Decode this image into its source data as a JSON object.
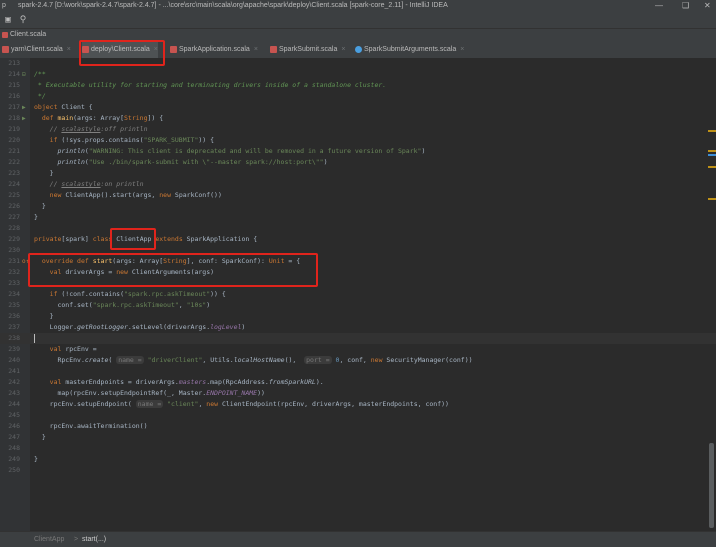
{
  "window": {
    "title": "spark-2.4.7 [D:\\work\\spark-2.4.7\\spark-2.4.7] - ...\\core\\src\\main\\scala\\org\\apache\\spark\\deploy\\Client.scala [spark-core_2.11] - IntelliJ IDEA",
    "logo": "p",
    "minimize": "—",
    "maximize": "❑",
    "close": "✕"
  },
  "breadcrumb": {
    "file": "Client.scala"
  },
  "tabs": [
    {
      "label": "yarn\\Client.scala",
      "icon": "scala-file-icon"
    },
    {
      "label": "deploy\\Client.scala",
      "icon": "scala-file-icon",
      "active": true
    },
    {
      "label": "SparkApplication.scala",
      "icon": "scala-file-icon"
    },
    {
      "label": "SparkSubmit.scala",
      "icon": "scala-file-icon"
    },
    {
      "label": "SparkSubmitArguments.scala",
      "icon": "scala-class-icon"
    }
  ],
  "tab_close": "×",
  "code": {
    "l213": "",
    "l214": "/**",
    "l215": " * Executable utility for starting and terminating drivers inside of a standalone cluster.",
    "l216": " */",
    "l217": {
      "a": "object",
      "b": " Client {"
    },
    "l218": {
      "a": "  def ",
      "b": "main",
      "c": "(args: Array[",
      "d": "String",
      "e": "]) {"
    },
    "l219": {
      "a": "    // ",
      "b": "scalastyle",
      "c": ":off println"
    },
    "l220": {
      "a": "    if",
      "b": " (!sys.props.contains(",
      "c": "\"SPARK_SUBMIT\"",
      "d": ")) {"
    },
    "l221": {
      "a": "      println",
      "b": "(",
      "c": "\"WARNING: This client is deprecated and will be removed in a future version of Spark\"",
      "d": ")"
    },
    "l222": {
      "a": "      println",
      "b": "(",
      "c": "\"Use ./bin/spark-submit with \\\"--master spark://host:port\\\"\"",
      "d": ")"
    },
    "l223": "    }",
    "l224": {
      "a": "    // ",
      "b": "scalastyle",
      "c": ":on println"
    },
    "l225": {
      "a": "    new",
      "b": " ClientApp().start(args, ",
      "c": "new",
      "d": " SparkConf())"
    },
    "l226": "  }",
    "l227": "}",
    "l228": "",
    "l229": {
      "a": "private",
      "b": "[spark] ",
      "c": "class",
      "d": " ClientApp ",
      "e": "extends",
      "f": " SparkApplication {"
    },
    "l230": "",
    "l231": {
      "a": "  override def ",
      "b": "start",
      "c": "(args: Array[",
      "d": "String",
      "e": "], conf: SparkConf): ",
      "f": "Unit",
      "g": " = {"
    },
    "l232": {
      "a": "    val",
      "b": " driverArgs = ",
      "c": "new",
      "d": " ClientArguments(args)"
    },
    "l233": "",
    "l234": {
      "a": "    if",
      "b": " (!conf.contains(",
      "c": "\"spark.rpc.askTimeout\"",
      "d": ")) {"
    },
    "l235": {
      "a": "      conf.set(",
      "b": "\"spark.rpc.askTimeout\"",
      "c": ", ",
      "d": "\"10s\"",
      "e": ")"
    },
    "l236": "    }",
    "l237": {
      "a": "    Logger.",
      "b": "getRootLogger",
      "c": ".setLevel(driverArgs.",
      "d": "logLevel",
      "e": ")"
    },
    "l238": "",
    "l239": {
      "a": "    val",
      "b": " rpcEnv ="
    },
    "l240": {
      "a": "      RpcEnv.",
      "b": "create",
      "c": "( ",
      "d": "name =",
      "e": " \"driverClient\"",
      "f": ", Utils.",
      "g": "localHostName",
      "h": "(),  ",
      "i": "port =",
      "j": " 0",
      "k": ", conf, ",
      "l": "new",
      "m": " SecurityManager(conf))"
    },
    "l241": "",
    "l242": {
      "a": "    val",
      "b": " masterEndpoints = driverArgs.",
      "c": "masters",
      "d": ".map(RpcAddress.",
      "e": "fromSparkURL",
      "f": ")."
    },
    "l243": {
      "a": "      map(rpcEnv.setupEndpointRef(_, Master.",
      "b": "ENDPOINT_NAME",
      "c": "))"
    },
    "l244": {
      "a": "    rpcEnv.setupEndpoint( ",
      "b": "name =",
      "c": " \"client\"",
      "d": ", ",
      "e": "new",
      "f": " ClientEndpoint(rpcEnv, driverArgs, masterEndpoints, conf))"
    },
    "l245": "",
    "l246": "    rpcEnv.awaitTermination()",
    "l247": "  }",
    "l248": "",
    "l249": "}",
    "l250": ""
  },
  "line_numbers": [
    "213",
    "214",
    "215",
    "216",
    "217",
    "218",
    "219",
    "220",
    "221",
    "222",
    "223",
    "224",
    "225",
    "226",
    "227",
    "228",
    "229",
    "230",
    "231",
    "232",
    "233",
    "234",
    "235",
    "236",
    "237",
    "238",
    "239",
    "240",
    "241",
    "242",
    "243",
    "244",
    "245",
    "246",
    "247",
    "248",
    "249",
    "250"
  ],
  "gutter": {
    "run": "▶",
    "override": "o↑",
    "fold": "⊟"
  },
  "status": {
    "class_crumb": "ClientApp",
    "sep": ">",
    "method_crumb": "start(...)"
  },
  "colors": {
    "highlight_box": "#e0241c",
    "background": "#2b2b2b",
    "keyword": "#cc7832",
    "string": "#6a8759"
  }
}
